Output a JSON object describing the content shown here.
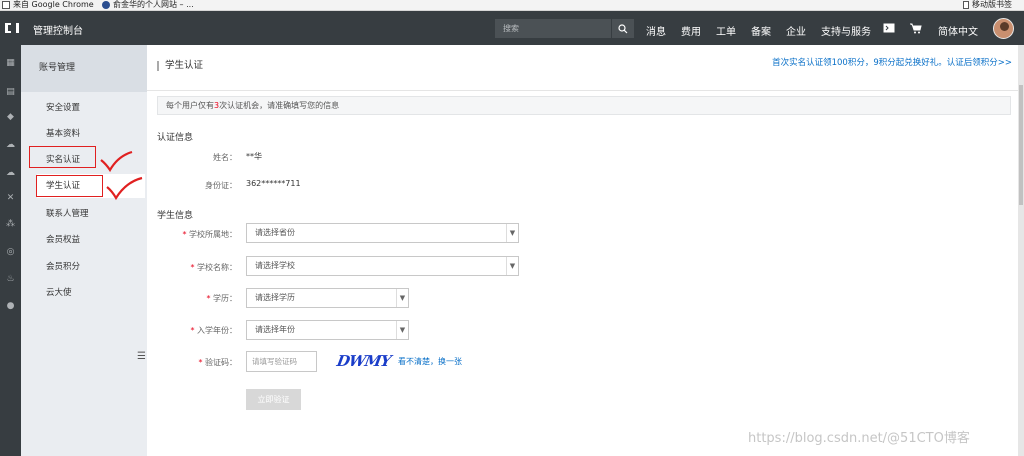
{
  "bookmarks": {
    "item1": "来自 Google Chrome",
    "item2": "俞金华的个人网站 – ...",
    "right": "移动版书签"
  },
  "header": {
    "console_title": "管理控制台",
    "search_placeholder": "搜索",
    "nav": [
      "消息",
      "费用",
      "工单",
      "备案",
      "企业",
      "支持与服务"
    ],
    "language": "简体中文"
  },
  "sidebar": {
    "title": "账号管理",
    "items": [
      "安全设置",
      "基本资料",
      "实名认证",
      "学生认证",
      "联系人管理",
      "会员权益",
      "会员积分",
      "云大使"
    ],
    "active_index": 3
  },
  "page": {
    "title": "学生认证",
    "promo": "首次实名认证领100积分，9积分起兑换好礼。认证后领积分>>",
    "notice_pre": "每个用户仅有",
    "notice_num": "3",
    "notice_post": "次认证机会，请准确填写您的信息",
    "auth_section": "认证信息",
    "name_label": "姓名：",
    "name_value": "**华",
    "id_label": "身份证：",
    "id_value": "362******711",
    "student_section": "学生信息",
    "school_region_label": "学校所属地：",
    "school_region_value": "请选择省份",
    "school_name_label": "学校名称：",
    "school_name_value": "请选择学校",
    "degree_label": "学历：",
    "degree_value": "请选择学历",
    "year_label": "入学年份：",
    "year_value": "请选择年份",
    "captcha_label": "验证码：",
    "captcha_placeholder": "请填写验证码",
    "captcha_text": "DWMY",
    "captcha_refresh": "看不清楚，换一张",
    "submit": "立即验证"
  },
  "watermark": "https://blog.csdn.net/@51CTO博客",
  "colors": {
    "topbar": "#373d41",
    "link": "#0a70c8",
    "required": "#e7001a",
    "annotation": "#e02020"
  }
}
